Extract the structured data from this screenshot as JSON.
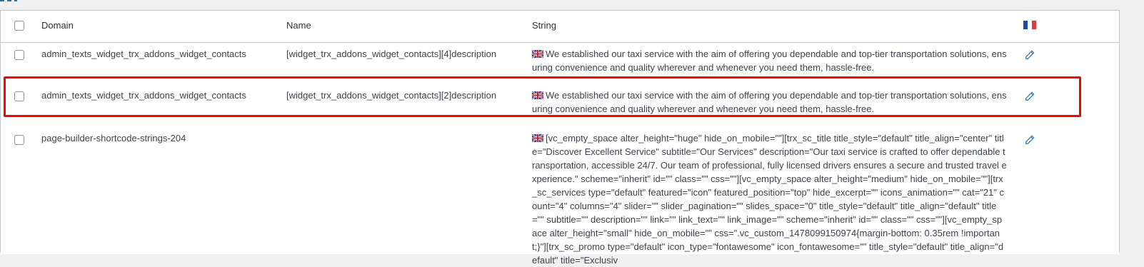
{
  "columns": {
    "domain": "Domain",
    "name": "Name",
    "string": "String",
    "lang_flag": "fr-flag-icon"
  },
  "rows": [
    {
      "domain": "admin_texts_widget_trx_addons_widget_contacts",
      "name": "[widget_trx_addons_widget_contacts][4]description",
      "string": "We established our taxi service with the aim of offering you dependable and top-tier transportation solutions, ensuring convenience and quality wherever and whenever you need them, hassle-free."
    },
    {
      "domain": "admin_texts_widget_trx_addons_widget_contacts",
      "name": "[widget_trx_addons_widget_contacts][2]description",
      "string": "We established our taxi service with the aim of offering you dependable and top-tier transportation solutions, ensuring convenience and quality wherever and whenever you need them, hassle-free.",
      "highlighted": true
    },
    {
      "domain": "page-builder-shortcode-strings-204",
      "name": "",
      "string": "[vc_empty_space alter_height=\"huge\" hide_on_mobile=\"\"][trx_sc_title title_style=\"default\" title_align=\"center\" title=\"Discover Excellent Service\" subtitle=\"Our Services\" description=\"Our taxi service is crafted to offer dependable transportation, accessible 24/7. Our team of professional, fully licensed drivers ensures a secure and trusted travel experience.\" scheme=\"inherit\" id=\"\" class=\"\" css=\"\"][vc_empty_space alter_height=\"medium\" hide_on_mobile=\"\"][trx_sc_services type=\"default\" featured=\"icon\" featured_position=\"top\" hide_excerpt=\"\" icons_animation=\"\" cat=\"21\" count=\"4\" columns=\"4\" slider=\"\" slider_pagination=\"\" slides_space=\"0\" title_style=\"default\" title_align=\"default\" title=\"\" subtitle=\"\" description=\"\" link=\"\" link_text=\"\" link_image=\"\" scheme=\"inherit\" id=\"\" class=\"\" css=\"\"][vc_empty_space alter_height=\"small\" hide_on_mobile=\"\" css=\".vc_custom_1478099150974{margin-bottom: 0.35rem !important;}\"][trx_sc_promo type=\"default\" icon_type=\"fontawesome\" icon_fontawesome=\"\" title_style=\"default\" title_align=\"default\" title=\"Exclusiv"
    }
  ],
  "colors": {
    "highlight": "#ff0000",
    "accent": "#2271b1"
  }
}
